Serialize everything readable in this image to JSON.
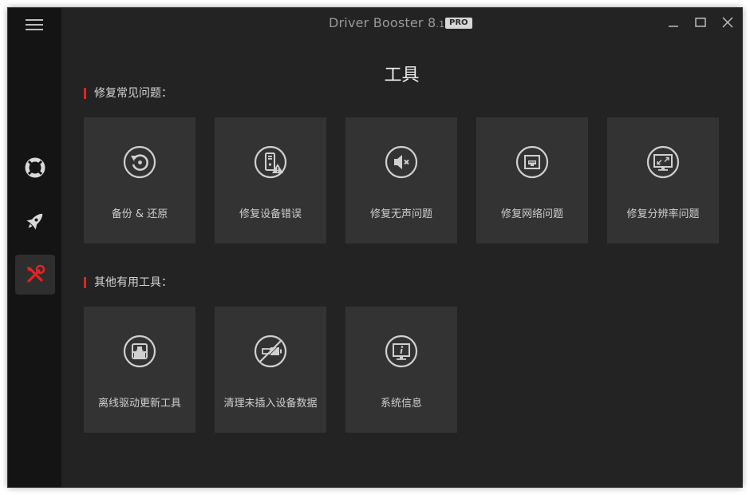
{
  "app": {
    "name": "Driver Booster 8",
    "version_minor": ".1",
    "badge": "PRO"
  },
  "sidebar": {
    "items": [
      {
        "name": "lifebuoy-icon",
        "active": false
      },
      {
        "name": "rocket-icon",
        "active": false
      },
      {
        "name": "tools-icon",
        "active": true
      }
    ]
  },
  "page": {
    "title": "工具"
  },
  "sections": [
    {
      "title": "修复常见问题：",
      "tiles": [
        {
          "label": "备份 & 还原",
          "icon": "backup-restore-icon"
        },
        {
          "label": "修复设备错误",
          "icon": "device-error-icon"
        },
        {
          "label": "修复无声问题",
          "icon": "no-sound-icon"
        },
        {
          "label": "修复网络问题",
          "icon": "network-icon"
        },
        {
          "label": "修复分辨率问题",
          "icon": "resolution-icon"
        }
      ]
    },
    {
      "title": "其他有用工具：",
      "tiles": [
        {
          "label": "离线驱动更新工具",
          "icon": "offline-update-icon"
        },
        {
          "label": "清理未插入设备数据",
          "icon": "unplugged-device-icon"
        },
        {
          "label": "系统信息",
          "icon": "system-info-icon"
        }
      ]
    }
  ],
  "colors": {
    "accent": "#e02424",
    "window_bg": "#232323",
    "sidebar_bg": "#141414",
    "tile_bg": "#333333"
  }
}
